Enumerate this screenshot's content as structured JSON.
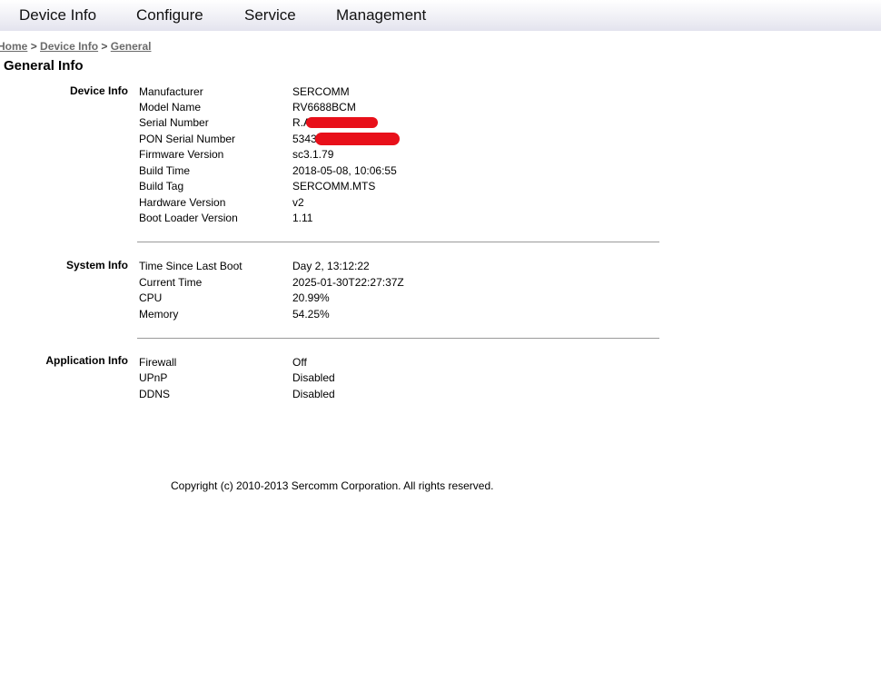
{
  "nav": {
    "items": [
      {
        "label": "Device Info"
      },
      {
        "label": "Configure"
      },
      {
        "label": "Service"
      },
      {
        "label": "Management"
      }
    ]
  },
  "breadcrumb": {
    "home": "Home",
    "sep": ">",
    "device_info": "Device Info",
    "general": "General"
  },
  "page_title": "General Info",
  "sections": {
    "device_info": {
      "label": "Device Info",
      "rows": [
        {
          "key": "Manufacturer",
          "value": "SERCOMM"
        },
        {
          "key": "Model Name",
          "value": "RV6688BCM"
        },
        {
          "key": "Serial Number",
          "value": "R.AV"
        },
        {
          "key": "PON Serial Number",
          "value": "5343"
        },
        {
          "key": "Firmware Version",
          "value": "sc3.1.79"
        },
        {
          "key": "Build Time",
          "value": "2018-05-08, 10:06:55"
        },
        {
          "key": "Build Tag",
          "value": "SERCOMM.MTS"
        },
        {
          "key": "Hardware Version",
          "value": "v2"
        },
        {
          "key": "Boot Loader Version",
          "value": "1.11"
        }
      ]
    },
    "system_info": {
      "label": "System Info",
      "rows": [
        {
          "key": "Time Since Last Boot",
          "value": "Day 2, 13:12:22"
        },
        {
          "key": "Current Time",
          "value": "2025-01-30T22:27:37Z"
        },
        {
          "key": "CPU",
          "value": "20.99%"
        },
        {
          "key": "Memory",
          "value": "54.25%"
        }
      ]
    },
    "application_info": {
      "label": "Application Info",
      "rows": [
        {
          "key": "Firewall",
          "value": "Off"
        },
        {
          "key": "UPnP",
          "value": "Disabled"
        },
        {
          "key": "DDNS",
          "value": "Disabled"
        }
      ]
    }
  },
  "copyright": "Copyright (c) 2010-2013 Sercomm Corporation. All rights reserved.",
  "colors": {
    "redaction": "#e8101a",
    "nav_gradient_end": "#e3e3ee"
  }
}
